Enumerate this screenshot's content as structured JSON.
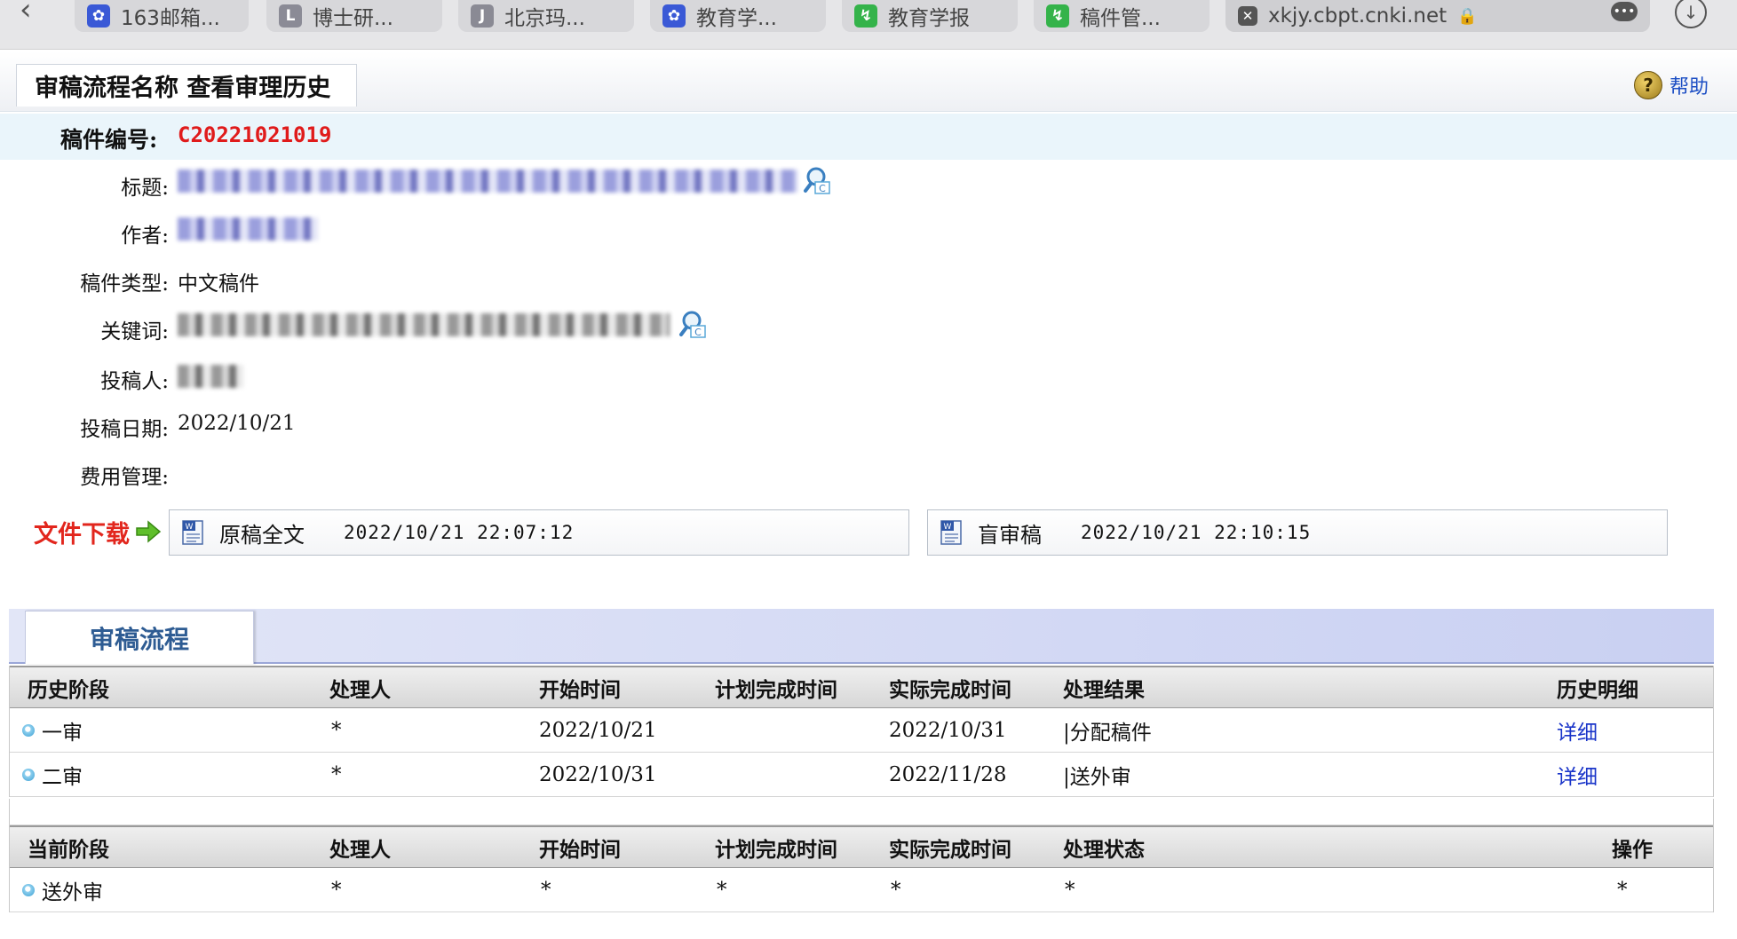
{
  "browser": {
    "tabs": [
      {
        "label": "163邮箱...",
        "icon": "baidu-paw-icon"
      },
      {
        "label": "博士研...",
        "icon": "letter-l-icon"
      },
      {
        "label": "北京玛...",
        "icon": "letter-j-icon"
      },
      {
        "label": "教育学...",
        "icon": "baidu-paw-icon"
      },
      {
        "label": "教育学报",
        "icon": "cnki-icon"
      },
      {
        "label": "稿件管...",
        "icon": "cnki-icon"
      },
      {
        "label": "xkjy.cbpt.cnki.net",
        "icon": "close-icon"
      }
    ],
    "more_label": "•••"
  },
  "header": {
    "title": "审稿流程名称 查看审理历史",
    "help_label": "帮助"
  },
  "manuscript": {
    "id_label": "稿件编号:",
    "id_value": "C20221021019",
    "fields": {
      "title_label": "标题:",
      "author_label": "作者:",
      "type_label": "稿件类型:",
      "type_value": "中文稿件",
      "keywords_label": "关键词:",
      "submitter_label": "投稿人:",
      "date_label": "投稿日期:",
      "date_value": "2022/10/21",
      "fee_label": "费用管理:"
    }
  },
  "downloads": {
    "label": "文件下载",
    "files": [
      {
        "name": "原稿全文",
        "time": "2022/10/21 22:07:12"
      },
      {
        "name": "盲审稿",
        "time": "2022/10/21 22:10:15"
      }
    ]
  },
  "workflow": {
    "tab_label": "审稿流程",
    "history": {
      "headers": [
        "历史阶段",
        "处理人",
        "开始时间",
        "计划完成时间",
        "实际完成时间",
        "处理结果",
        "历史明细"
      ],
      "rows": [
        {
          "stage": "一审",
          "handler": "*",
          "start": "2022/10/21",
          "planned": "",
          "actual": "2022/10/31",
          "result": "|分配稿件",
          "detail": "详细"
        },
        {
          "stage": "二审",
          "handler": "*",
          "start": "2022/10/31",
          "planned": "",
          "actual": "2022/11/28",
          "result": "|送外审",
          "detail": "详细"
        }
      ]
    },
    "current": {
      "headers": [
        "当前阶段",
        "处理人",
        "开始时间",
        "计划完成时间",
        "实际完成时间",
        "处理状态",
        "操作"
      ],
      "rows": [
        {
          "stage": "送外审",
          "handler": "*",
          "start": "*",
          "planned": "*",
          "actual": "*",
          "status": "*",
          "action": "*"
        }
      ]
    }
  }
}
